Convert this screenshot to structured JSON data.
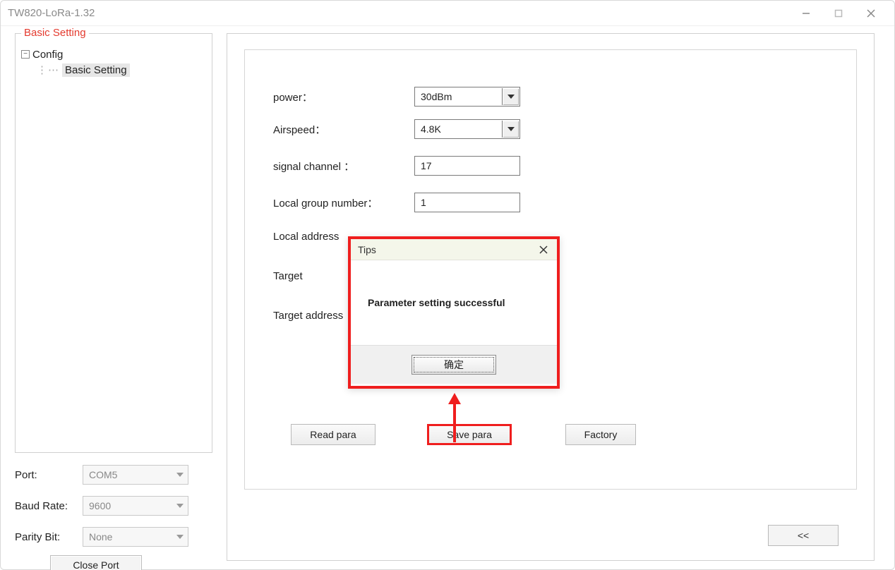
{
  "window": {
    "title": "TW820-LoRa-1.32"
  },
  "sidebar": {
    "legend": "Basic Setting",
    "tree": {
      "root": "Config",
      "child": "Basic Setting"
    }
  },
  "port_controls": {
    "port_label": "Port:",
    "port_value": "COM5",
    "baud_label": "Baud Rate:",
    "baud_value": "9600",
    "parity_label": "Parity Bit:",
    "parity_value": "None",
    "close_port": "Close Port"
  },
  "fields": {
    "power_label": "power：",
    "power_value": "30dBm",
    "airspeed_label": "Airspeed：",
    "airspeed_value": "4.8K",
    "signal_label": "signal channel ：",
    "signal_value": "17",
    "group_label": "Local group number：",
    "group_value": "1",
    "local_addr_label": "Local address",
    "target_label": "Target",
    "target_addr_label": "Target address"
  },
  "buttons": {
    "read": "Read para",
    "save": "Save para",
    "factory": "Factory",
    "back": "<<"
  },
  "dialog": {
    "title": "Tips",
    "message": "Parameter setting successful",
    "ok": "确定"
  }
}
